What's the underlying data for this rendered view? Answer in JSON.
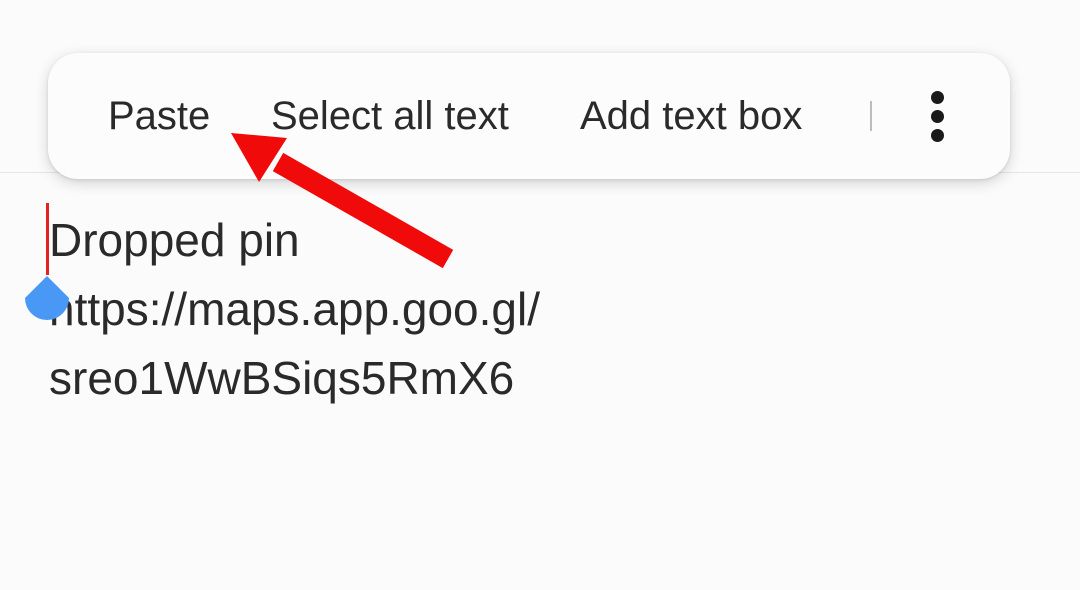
{
  "context_menu": {
    "items": [
      {
        "label": "Paste"
      },
      {
        "label": "Select all text"
      },
      {
        "label": "Add text box"
      }
    ],
    "more_icon": "more-vertical-icon"
  },
  "editor": {
    "lines": [
      "Dropped pin",
      "https://maps.app.goo.gl/",
      "sreo1WwBSiqs5RmX6"
    ]
  },
  "colors": {
    "annotation_arrow": "#f00a0a",
    "cursor": "#e3231f",
    "cursor_handle": "#4a98f5",
    "text": "#2a2a2a",
    "background": "#fbfbfb"
  }
}
